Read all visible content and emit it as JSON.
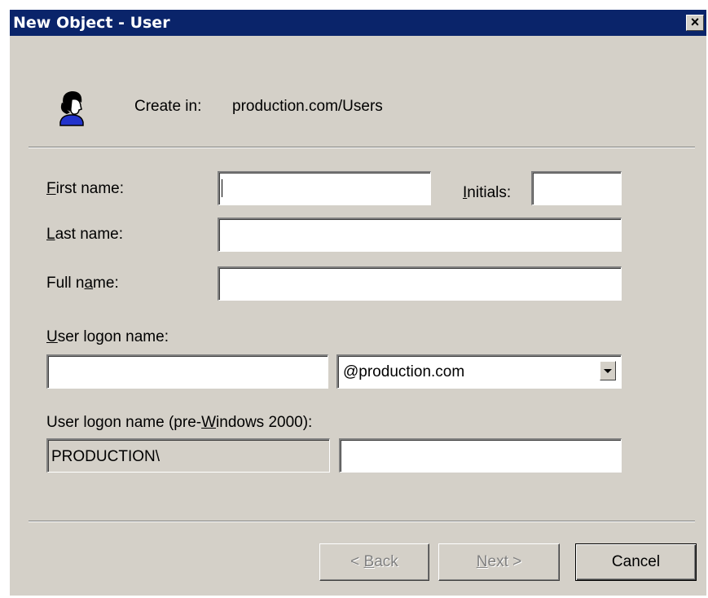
{
  "window": {
    "title": "New Object - User",
    "close_glyph": "×"
  },
  "header": {
    "icon": "user-icon",
    "create_in_label": "Create in:",
    "create_in_value": "production.com/Users"
  },
  "form": {
    "first_name": {
      "label_mnemonic": "F",
      "label_rest": "irst name:",
      "value": ""
    },
    "initials": {
      "label_mnemonic": "I",
      "label_rest": "nitials:",
      "value": ""
    },
    "last_name": {
      "label_mnemonic": "L",
      "label_rest": "ast name:",
      "value": ""
    },
    "full_name": {
      "label_pre": "Full n",
      "label_mnemonic": "a",
      "label_rest": "me:",
      "value": ""
    },
    "logon_name": {
      "label_mnemonic": "U",
      "label_rest": "ser logon name:",
      "value": "",
      "domain_selected": "@production.com"
    },
    "pre2000": {
      "label_pre": "User logon name (pre-",
      "label_mnemonic": "W",
      "label_rest": "indows 2000):",
      "domain_value": "PRODUCTION\\",
      "value": ""
    }
  },
  "buttons": {
    "back": {
      "pre": "< ",
      "mnemonic": "B",
      "rest": "ack"
    },
    "next": {
      "pre": "",
      "mnemonic": "N",
      "rest": "ext >"
    },
    "cancel": "Cancel"
  },
  "colors": {
    "titlebar": "#0a246a",
    "face": "#d4d0c8",
    "disabled_text": "#808080"
  }
}
